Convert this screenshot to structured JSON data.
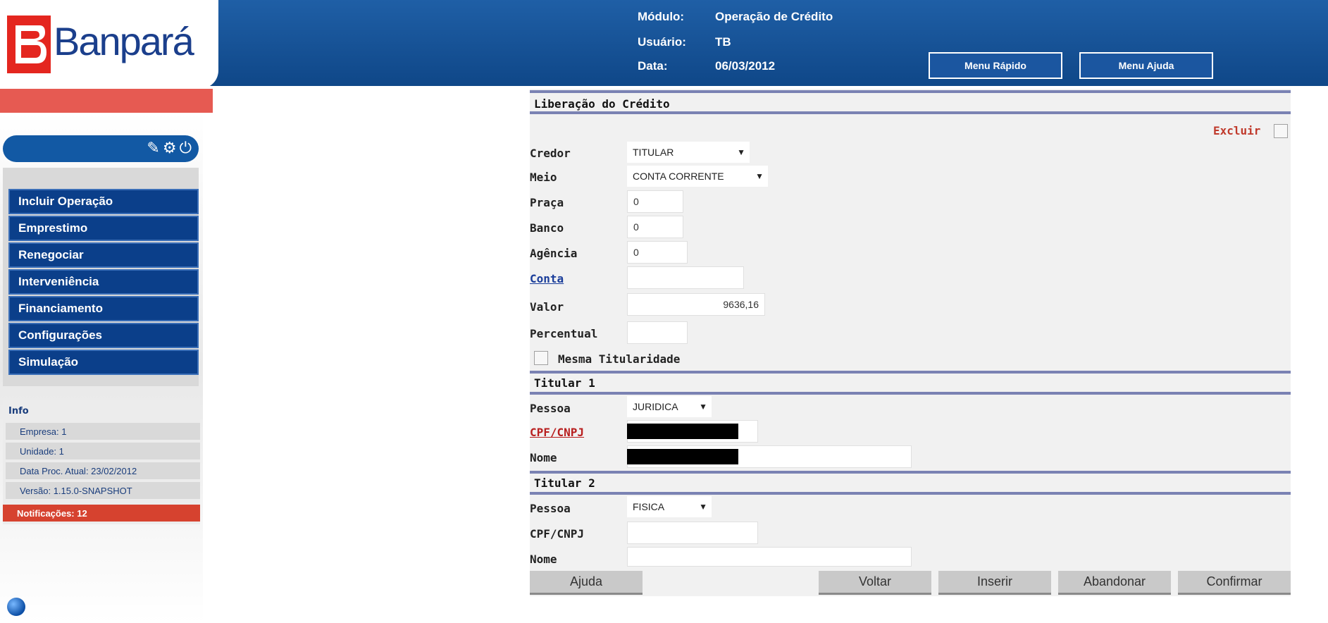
{
  "header": {
    "logo_text": "Banpará",
    "module_label": "Módulo:",
    "module_value": "Operação de Crédito",
    "user_label": "Usuário:",
    "user_value": "TB",
    "date_label": "Data:",
    "date_value": "06/03/2012",
    "quick_menu": "Menu Rápido",
    "help_menu": "Menu Ajuda"
  },
  "sidebar": {
    "tools": [
      "notes-icon",
      "gear-icon",
      "power-icon"
    ],
    "menu": [
      "Incluir Operação",
      "Emprestimo",
      "Renegociar",
      "Interveniência",
      "Financiamento",
      "Configurações",
      "Simulação"
    ],
    "info_title": "Info",
    "info": [
      "Empresa: 1",
      "Unidade: 1",
      "Data Proc. Atual: 23/02/2012",
      "Versão: 1.15.0-SNAPSHOT"
    ],
    "notifications": "Notificações: 12"
  },
  "form": {
    "title": "Liberação do Crédito",
    "delete_label": "Excluir",
    "credor_label": "Credor",
    "credor_value": "TITULAR",
    "meio_label": "Meio",
    "meio_value": "CONTA CORRENTE",
    "praca_label": "Praça",
    "praca_value": "0",
    "banco_label": "Banco",
    "banco_value": "0",
    "agencia_label": "Agência",
    "agencia_value": "0",
    "conta_label": "Conta",
    "conta_value": "",
    "valor_label": "Valor",
    "valor_value": "9636,16",
    "percentual_label": "Percentual",
    "percentual_value": "",
    "mesma_titularidade": "Mesma Titularidade",
    "titular1_title": "Titular 1",
    "titular1_pessoa_label": "Pessoa",
    "titular1_pessoa_value": "JURIDICA",
    "titular1_cpf_label": "CPF/CNPJ",
    "titular1_nome_label": "Nome",
    "titular2_title": "Titular 2",
    "titular2_pessoa_label": "Pessoa",
    "titular2_pessoa_value": "FISICA",
    "titular2_cpf_label": "CPF/CNPJ",
    "titular2_nome_label": "Nome"
  },
  "buttons": {
    "ajuda": "Ajuda",
    "voltar": "Voltar",
    "inserir": "Inserir",
    "abandonar": "Abandonar",
    "confirmar": "Confirmar"
  },
  "colors": {
    "header_blue": "#0f4788",
    "menu_blue": "#0b3f8a",
    "accent_red": "#d6422f",
    "separator": "#7a82b3"
  }
}
